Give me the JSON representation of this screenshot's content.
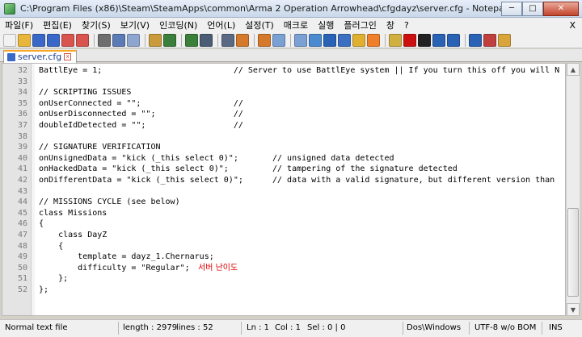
{
  "window": {
    "title": "C:\\Program Files (x86)\\Steam\\SteamApps\\common\\Arma 2 Operation Arrowhead\\cfgdayz\\server.cfg - Notepad++ [Administrator]",
    "minimize": "─",
    "maximize": "□",
    "close": "✕"
  },
  "menu": {
    "items": [
      "파일(F)",
      "편집(E)",
      "찾기(S)",
      "보기(V)",
      "인코딩(N)",
      "언어(L)",
      "설정(T)",
      "매크로",
      "실행",
      "플러그인",
      "창",
      "?"
    ],
    "close_x": "X"
  },
  "toolbar": {
    "buttons": [
      {
        "name": "new-file-icon",
        "color": "#f2f2f2"
      },
      {
        "name": "open-file-icon",
        "color": "#e8b63a"
      },
      {
        "name": "save-icon",
        "color": "#3a68c8"
      },
      {
        "name": "save-all-icon",
        "color": "#3a68c8"
      },
      {
        "name": "close-file-icon",
        "color": "#d9534f"
      },
      {
        "name": "close-all-icon",
        "color": "#d9534f"
      },
      {
        "name": "print-icon",
        "color": "#6e6e6e"
      },
      {
        "name": "cut-icon",
        "color": "#5a7bb6"
      },
      {
        "name": "copy-icon",
        "color": "#8ea6cf"
      },
      {
        "name": "paste-icon",
        "color": "#c99b3b"
      },
      {
        "name": "undo-icon",
        "color": "#3a7f3a"
      },
      {
        "name": "redo-icon",
        "color": "#3a7f3a"
      },
      {
        "name": "find-icon",
        "color": "#4b5d75"
      },
      {
        "name": "replace-icon",
        "color": "#5b6a84"
      },
      {
        "name": "zoom-in-icon",
        "color": "#d47a2a"
      },
      {
        "name": "zoom-out-icon",
        "color": "#d47a2a"
      },
      {
        "name": "sync-vertical-icon",
        "color": "#7aa0d4"
      },
      {
        "name": "sync-horizontal-icon",
        "color": "#7aa0d4"
      },
      {
        "name": "word-wrap-icon",
        "color": "#4a8ad0"
      },
      {
        "name": "all-chars-icon",
        "color": "#2a62b5"
      },
      {
        "name": "indent-guide-icon",
        "color": "#3b6fc1"
      },
      {
        "name": "udl-icon",
        "color": "#e0b030"
      },
      {
        "name": "doc-map-icon",
        "color": "#f07f2a"
      },
      {
        "name": "function-list-icon",
        "color": "#d0b040"
      },
      {
        "name": "record-macro-icon",
        "color": "#cc1010"
      },
      {
        "name": "stop-macro-icon",
        "color": "#222222"
      },
      {
        "name": "play-macro-icon",
        "color": "#2a62b5"
      },
      {
        "name": "run-macro-multiple-icon",
        "color": "#2a62b5"
      },
      {
        "name": "save-macro-icon",
        "color": "#2a62b5"
      },
      {
        "name": "spell-check-icon",
        "color": "#c04040"
      },
      {
        "name": "plugin-icon",
        "color": "#d9a43a"
      }
    ]
  },
  "tab": {
    "label": "server.cfg",
    "close": "x"
  },
  "editor": {
    "lines": [
      {
        "n": "32",
        "text": "BattlEye = 1;                           // Server to use BattlEye system || If you turn this off you will N"
      },
      {
        "n": "33",
        "text": ""
      },
      {
        "n": "34",
        "text": "// SCRIPTING ISSUES"
      },
      {
        "n": "35",
        "text": "onUserConnected = \"\";                   //"
      },
      {
        "n": "36",
        "text": "onUserDisconnected = \"\";                //"
      },
      {
        "n": "37",
        "text": "doubleIdDetected = \"\";                  //"
      },
      {
        "n": "38",
        "text": ""
      },
      {
        "n": "39",
        "text": "// SIGNATURE VERIFICATION"
      },
      {
        "n": "40",
        "text": "onUnsignedData = \"kick (_this select 0)\";       // unsigned data detected"
      },
      {
        "n": "41",
        "text": "onHackedData = \"kick (_this select 0)\";         // tampering of the signature detected"
      },
      {
        "n": "42",
        "text": "onDifferentData = \"kick (_this select 0)\";      // data with a valid signature, but different version than"
      },
      {
        "n": "43",
        "text": ""
      },
      {
        "n": "44",
        "text": "// MISSIONS CYCLE (see below)"
      },
      {
        "n": "45",
        "text": "class Missions"
      },
      {
        "n": "46",
        "text": "{"
      },
      {
        "n": "47",
        "text": "    class DayZ"
      },
      {
        "n": "48",
        "text": "    {"
      },
      {
        "n": "49",
        "text": "        template = dayz_1.Chernarus;"
      },
      {
        "n": "50",
        "text": "        difficulty = \"Regular\";"
      },
      {
        "n": "51",
        "text": "    };"
      },
      {
        "n": "52",
        "text": "};"
      }
    ],
    "annotation": "서버 난이도"
  },
  "status": {
    "filetype": "Normal text file",
    "length": "length : 2979",
    "lines": "lines : 52",
    "ln": "Ln : 1",
    "col": "Col : 1",
    "sel": "Sel : 0 | 0",
    "eol": "Dos\\Windows",
    "encoding": "UTF-8 w/o BOM",
    "mode": "INS"
  }
}
